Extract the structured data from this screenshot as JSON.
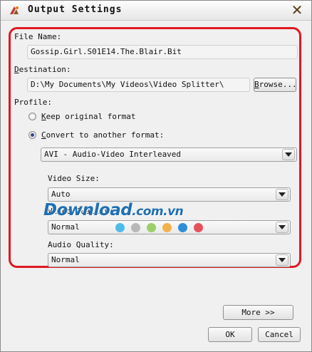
{
  "window": {
    "title": "Output Settings",
    "close_symbol": "✕"
  },
  "file_name": {
    "label": "File Name:",
    "value": "Gossip.Girl.S01E14.The.Blair.Bit"
  },
  "destination": {
    "label_first": "D",
    "label_rest": "estination:",
    "value": "D:\\My Documents\\My Videos\\Video Splitter\\",
    "browse_first": "B",
    "browse_rest": "rowse..."
  },
  "profile": {
    "label": "Profile:",
    "keep_first": "K",
    "keep_rest": "eep original format",
    "keep_selected": false,
    "convert_first": "C",
    "convert_rest": "onvert to another format:",
    "convert_selected": true,
    "format_value": "AVI - Audio-Video Interleaved"
  },
  "video_size": {
    "label": "Video Size:",
    "value": "Auto"
  },
  "video_quality": {
    "label": "Video Quality:",
    "value": "Normal"
  },
  "audio_quality": {
    "label": "Audio Quality:",
    "value": "Normal"
  },
  "watermark": {
    "main": "Download",
    "domain": ".com.vn"
  },
  "dot_colors": [
    "#4dbde8",
    "#b8b8b8",
    "#9bcf6a",
    "#f2b24a",
    "#2f8fd4",
    "#e6525a"
  ],
  "buttons": {
    "more": "More >>",
    "ok": "OK",
    "cancel": "Cancel"
  }
}
